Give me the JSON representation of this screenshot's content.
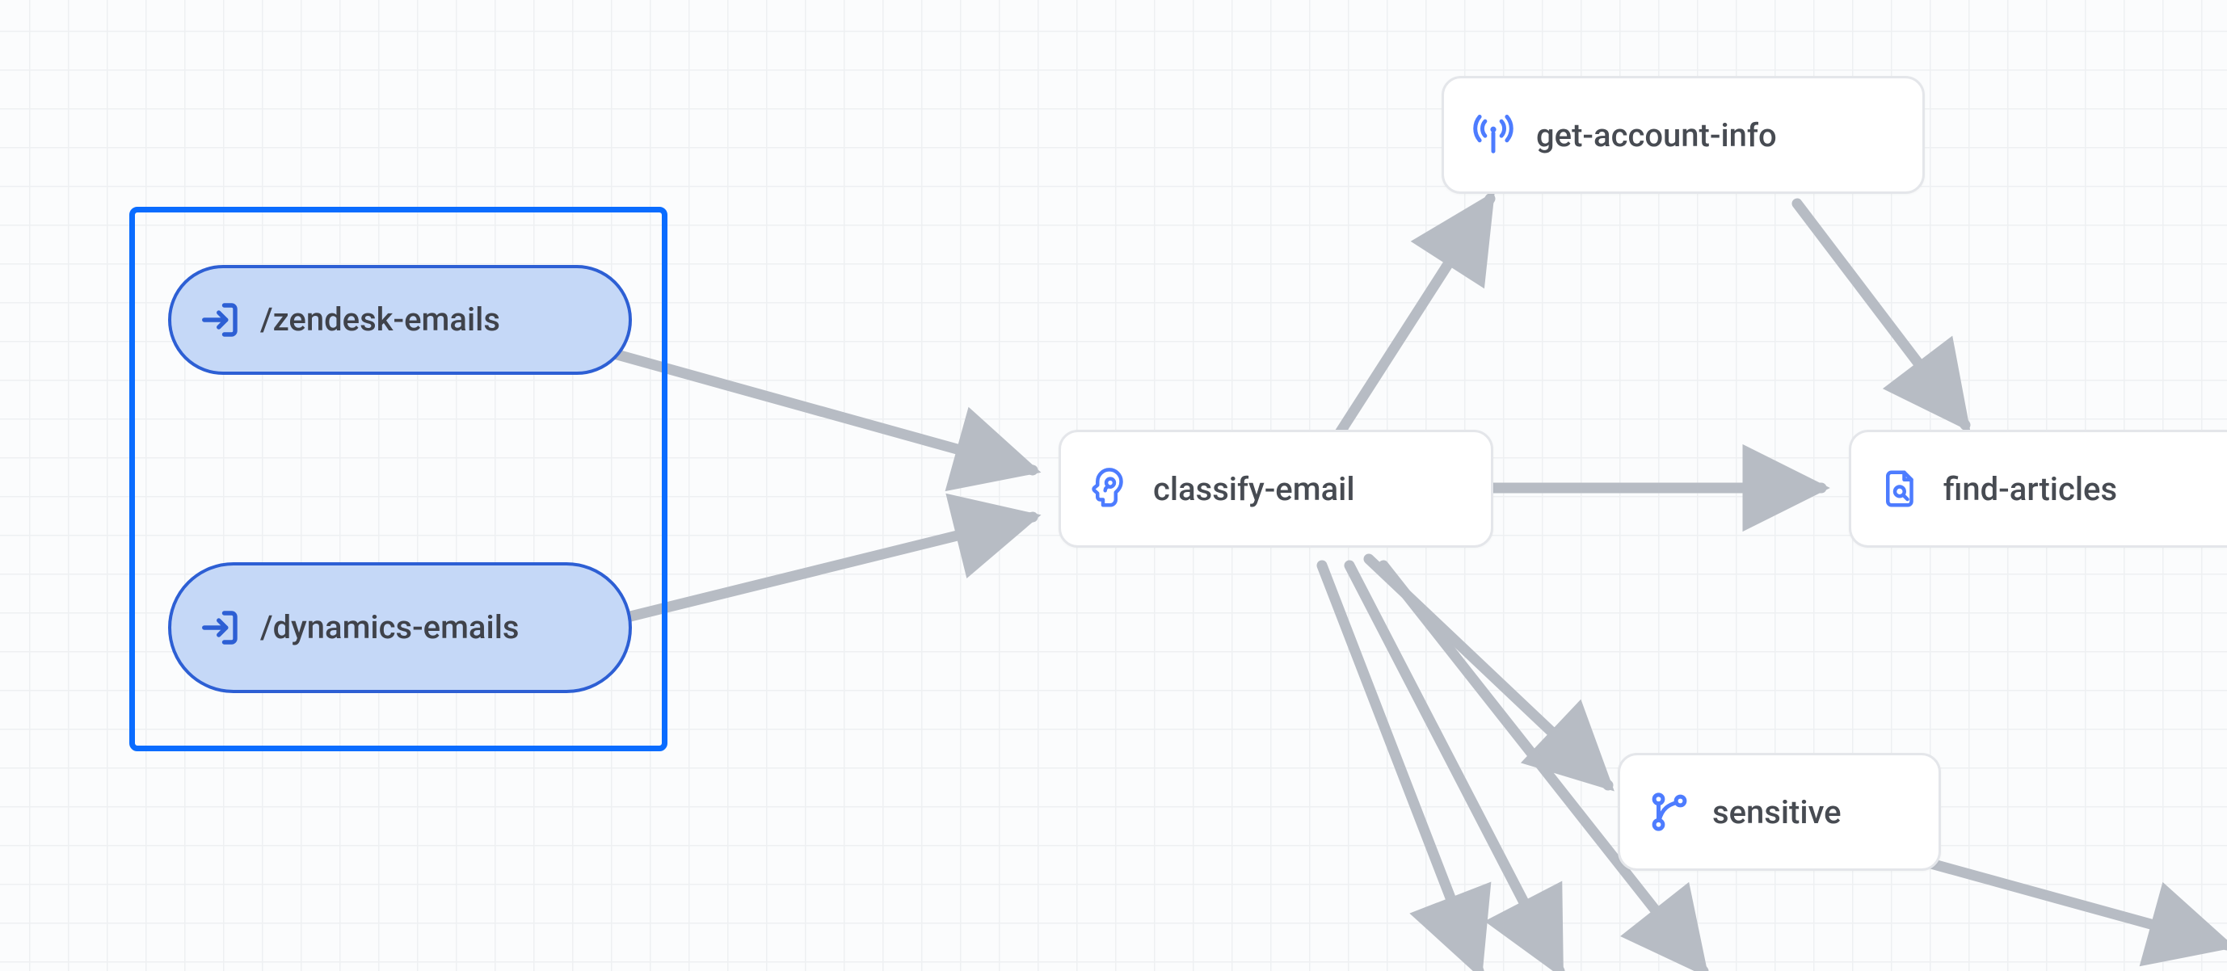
{
  "inputs": {
    "zendesk": {
      "label": "/zendesk-emails"
    },
    "dynamics": {
      "label": "/dynamics-emails"
    }
  },
  "nodes": {
    "classify": {
      "label": "classify-email",
      "icon": "brain-head"
    },
    "account": {
      "label": "get-account-info",
      "icon": "antenna"
    },
    "articles": {
      "label": "find-articles",
      "icon": "file-search"
    },
    "sensitive": {
      "label": "sensitive",
      "icon": "branch"
    }
  },
  "colors": {
    "accent": "#0a6cff",
    "pill_bg": "#c5d8f7",
    "pill_border": "#2d5fd4",
    "icon": "#4d7cff",
    "arrow": "#b7bcc4",
    "node_border": "#e4e6ea",
    "text": "#474b52"
  },
  "edges": [
    {
      "from": "zendesk",
      "to": "classify"
    },
    {
      "from": "dynamics",
      "to": "classify"
    },
    {
      "from": "classify",
      "to": "account"
    },
    {
      "from": "classify",
      "to": "articles"
    },
    {
      "from": "classify",
      "to": "sensitive"
    },
    {
      "from": "account",
      "to": "articles"
    },
    {
      "from": "sensitive",
      "to": "offscreen-right"
    },
    {
      "from": "classify",
      "to": "offscreen-bottom-1"
    },
    {
      "from": "classify",
      "to": "offscreen-bottom-2"
    },
    {
      "from": "classify",
      "to": "offscreen-bottom-3"
    }
  ]
}
